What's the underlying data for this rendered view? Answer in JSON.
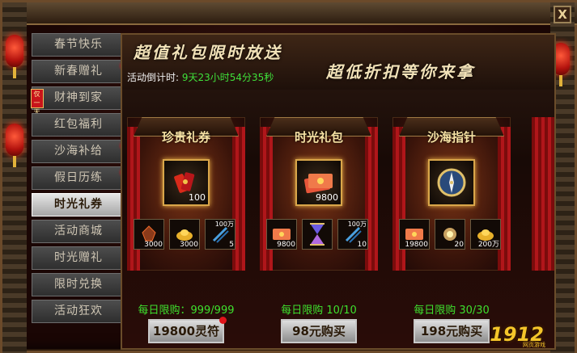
{
  "sidebar": {
    "items": [
      {
        "label": "春节快乐",
        "dot": false,
        "tag": ""
      },
      {
        "label": "新春赠礼",
        "dot": true,
        "tag": ""
      },
      {
        "label": "财神到家",
        "dot": false,
        "tag": "仅一天"
      },
      {
        "label": "红包福利",
        "dot": false,
        "tag": ""
      },
      {
        "label": "沙海补给",
        "dot": true,
        "tag": ""
      },
      {
        "label": "假日历练",
        "dot": true,
        "tag": ""
      },
      {
        "label": "时光礼券",
        "dot": false,
        "tag": "",
        "active": true
      },
      {
        "label": "活动商城",
        "dot": false,
        "tag": ""
      },
      {
        "label": "时光赠礼",
        "dot": false,
        "tag": ""
      },
      {
        "label": "限时兑换",
        "dot": false,
        "tag": ""
      },
      {
        "label": "活动狂欢",
        "dot": false,
        "tag": ""
      }
    ]
  },
  "banner": {
    "title1": "超值礼包限时放送",
    "title2": "超低折扣等你来拿",
    "countdown_label": "活动倒计时:",
    "countdown_value": "9天23小时54分35秒"
  },
  "cards": [
    {
      "name": "珍贵礼券",
      "main_icon": "coupon-bundle-icon",
      "main_qty": "100",
      "subs": [
        {
          "icon": "ore-icon",
          "qty": "3000",
          "qty_top": ""
        },
        {
          "icon": "gold-ingot-icon",
          "qty": "3000",
          "qty_top": ""
        },
        {
          "icon": "arrows-icon",
          "qty": "5",
          "qty_top": "100万"
        }
      ],
      "limit": "每日限购：999/999",
      "button": "19800灵符",
      "button_dot": true
    },
    {
      "name": "时光礼包",
      "main_icon": "red-packet-icon",
      "main_qty": "9800",
      "subs": [
        {
          "icon": "red-packet-icon",
          "qty": "9800",
          "qty_top": ""
        },
        {
          "icon": "hourglass-icon",
          "qty": "",
          "qty_top": ""
        },
        {
          "icon": "arrows-icon",
          "qty": "10",
          "qty_top": "100万"
        }
      ],
      "limit": "每日限购  10/10",
      "button": "98元购买",
      "button_dot": false
    },
    {
      "name": "沙海指针",
      "main_icon": "compass-icon",
      "main_qty": "",
      "subs": [
        {
          "icon": "red-packet-icon",
          "qty": "19800",
          "qty_top": ""
        },
        {
          "icon": "spark-ore-icon",
          "qty": "20",
          "qty_top": ""
        },
        {
          "icon": "gold-ingot-icon",
          "qty": "200万",
          "qty_top": ""
        }
      ],
      "limit": "每日限购  30/30",
      "button": "198元购买",
      "button_dot": false
    }
  ],
  "logo": {
    "text": "1912",
    "sub": "网页游戏"
  },
  "close_label": "X"
}
